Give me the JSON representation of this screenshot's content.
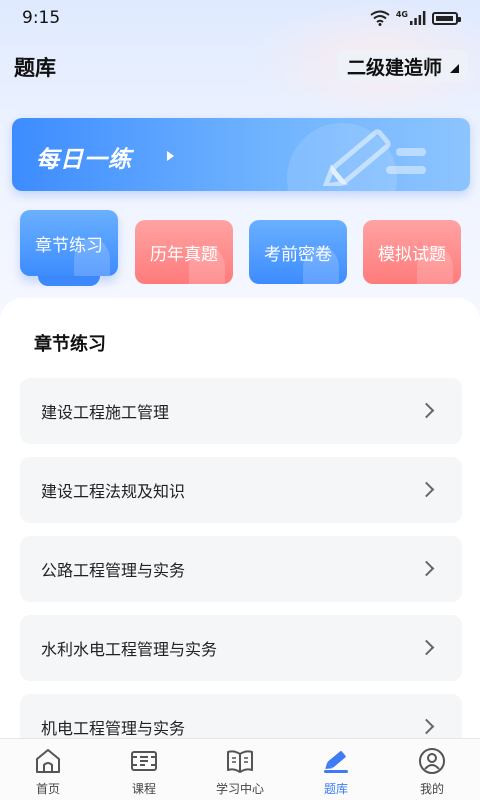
{
  "status_bar": {
    "time": "9:15",
    "network_label": "4G"
  },
  "header": {
    "title": "题库",
    "exam_selector": "二级建造师"
  },
  "daily_practice": {
    "label": "每日一练"
  },
  "categories": [
    {
      "label": "章节练习",
      "color": "#3d8cff",
      "active": true
    },
    {
      "label": "历年真题",
      "color": "#ff7b7b",
      "active": false
    },
    {
      "label": "考前密卷",
      "color": "#3d8cff",
      "active": false
    },
    {
      "label": "模拟试题",
      "color": "#ff7b7b",
      "active": false
    }
  ],
  "section": {
    "title": "章节练习",
    "subjects": [
      {
        "label": "建设工程施工管理"
      },
      {
        "label": "建设工程法规及知识"
      },
      {
        "label": "公路工程管理与实务"
      },
      {
        "label": "水利水电工程管理与实务"
      },
      {
        "label": "机电工程管理与实务"
      }
    ]
  },
  "bottom_nav": {
    "items": [
      {
        "label": "首页",
        "icon": "home-icon",
        "active": false
      },
      {
        "label": "课程",
        "icon": "course-icon",
        "active": false
      },
      {
        "label": "学习中心",
        "icon": "book-icon",
        "active": false
      },
      {
        "label": "题库",
        "icon": "pen-icon",
        "active": true
      },
      {
        "label": "我的",
        "icon": "user-icon",
        "active": false
      }
    ],
    "active_color": "#3d7cf5"
  }
}
